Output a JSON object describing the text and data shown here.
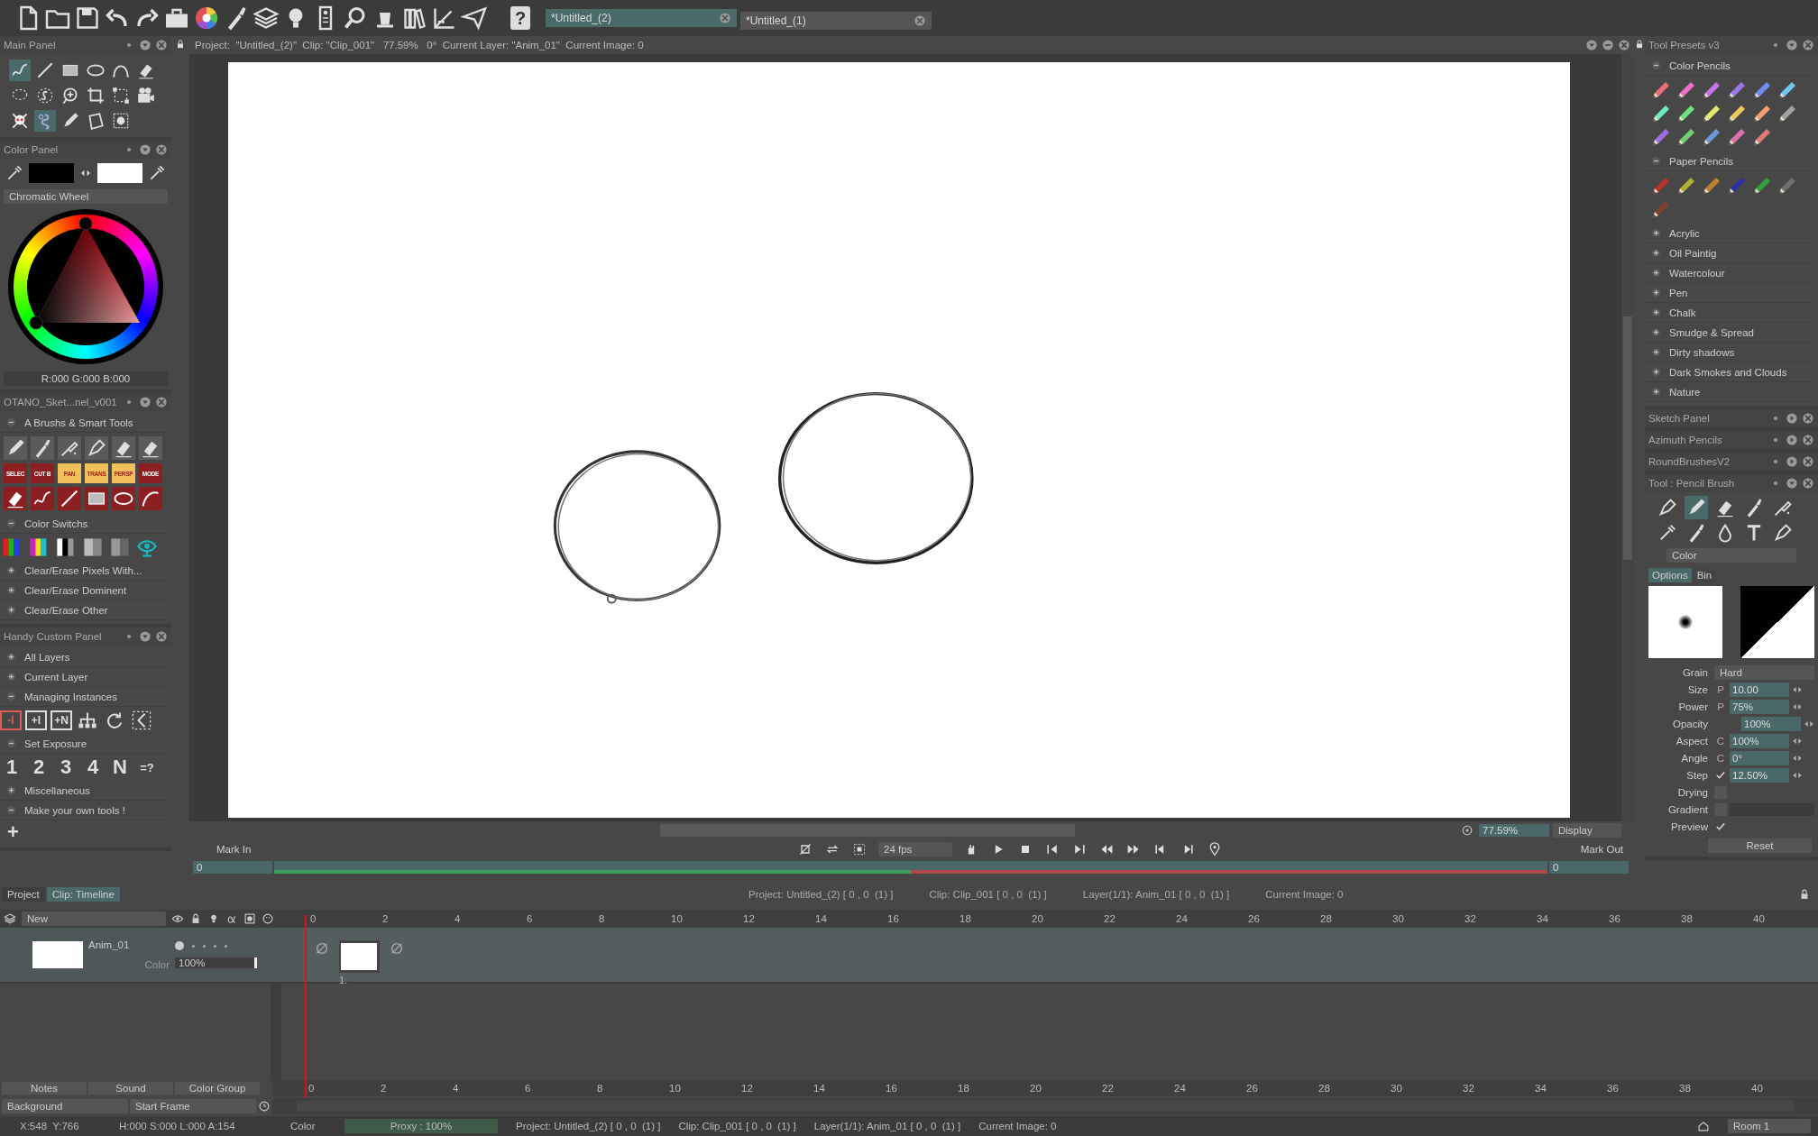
{
  "toolbar": {
    "help_label": "?",
    "documents": [
      {
        "title": "*Untitled_(2)",
        "selected": true
      },
      {
        "title": "*Untitled_(1)",
        "selected": false
      }
    ]
  },
  "left_panels": [
    {
      "kind": "main_tools",
      "title": "Main Panel",
      "expanded": true
    },
    {
      "kind": "color",
      "title": "Color Panel",
      "expanded": true,
      "mode": "Chromatic Wheel",
      "readout": "R:000 G:000 B:000"
    },
    {
      "kind": "groups",
      "title": "OTANO_Sket...nel_v001",
      "expanded": true,
      "groups": [
        {
          "kind": "brush_tools",
          "label": "A Brushs & Smart Tools",
          "expanded": true,
          "buttons": [
            {
              "label": "SELEC",
              "color": "#8b1f22"
            },
            {
              "label": "CUT B",
              "color": "#8b1f22"
            },
            {
              "label": "PAN",
              "color": "#f2c05a"
            },
            {
              "label": "TRANS",
              "color": "#f2c05a"
            },
            {
              "label": "PERSP",
              "color": "#f2c05a"
            },
            {
              "label": "MODE",
              "color": "#8b1f22"
            }
          ]
        },
        {
          "kind": "swatches",
          "label": "Color Switchs",
          "expanded": true
        },
        {
          "label": "Clear/Erase Pixels With...",
          "expanded": false
        },
        {
          "label": "Clear/Erase Dominent",
          "expanded": false
        },
        {
          "label": "Clear/Erase Other",
          "expanded": false
        }
      ]
    },
    {
      "kind": "groups",
      "title": "Handy Custom Panel",
      "expanded": true,
      "add_label": "+",
      "groups": [
        {
          "label": "All Layers",
          "expanded": false
        },
        {
          "label": "Current Layer",
          "expanded": false
        },
        {
          "kind": "instances",
          "label": "Managing Instances",
          "expanded": true,
          "buttons": [
            {
              "label": "-I",
              "color": "#e05a5a"
            },
            {
              "label": "+I",
              "color": "#dddddd"
            },
            {
              "label": "+N",
              "color": "#dddddd"
            }
          ]
        },
        {
          "kind": "exposure",
          "label": "Set Exposure",
          "expanded": true,
          "buttons": [
            "1",
            "2",
            "3",
            "4",
            "N",
            "=?"
          ]
        },
        {
          "label": "Miscellaneous",
          "expanded": false
        },
        {
          "label": "Make your own tools !",
          "expanded": true
        }
      ]
    }
  ],
  "canvas": {
    "info": "Project:  \"Untitled_(2)\"  Clip: \"Clip_001\"   77.59%   0°  Current Layer: \"Anim_01\"  Current Image: 0",
    "zoom": "77.59%",
    "view_mode": "Display",
    "mark_in": "Mark In",
    "mark_out": "Mark Out",
    "fps": "24 fps",
    "start_frame": "0",
    "end_frame": "0",
    "cache": {
      "level": 0.5
    }
  },
  "right_panels": [
    {
      "kind": "presets",
      "title": "Tool Presets v3",
      "expanded": true,
      "groups": [
        {
          "kind": "pencils",
          "label": "Color Pencils",
          "expanded": true,
          "pencils": [
            {
              "color": "#e8707a"
            },
            {
              "color": "#ee6fc8"
            },
            {
              "color": "#c874e6"
            },
            {
              "color": "#9a78ea"
            },
            {
              "color": "#6f8cf0"
            },
            {
              "color": "#6cc8f0"
            },
            {
              "color": "#6ee8c0"
            },
            {
              "color": "#6ee080"
            },
            {
              "color": "#e0e870"
            },
            {
              "color": "#f0c860"
            },
            {
              "color": "#f0a070"
            },
            {
              "color": "#a0a0a0"
            },
            {
              "color": "#9a70e0"
            },
            {
              "color": "#70d070"
            },
            {
              "color": "#6a98d8"
            },
            {
              "color": "#e070a8"
            },
            {
              "color": "#e07a7a"
            }
          ]
        },
        {
          "kind": "pencils",
          "label": "Paper Pencils",
          "expanded": true,
          "pencils": [
            {
              "color": "#b83030"
            },
            {
              "color": "#b0b030"
            },
            {
              "color": "#c08030"
            },
            {
              "color": "#3030a0"
            },
            {
              "color": "#30a040"
            },
            {
              "color": "#707070"
            },
            {
              "color": "#804030"
            }
          ]
        },
        {
          "label": "Acrylic",
          "expanded": false
        },
        {
          "label": "Oil Paintig",
          "expanded": false
        },
        {
          "label": "Watercolour",
          "expanded": false
        },
        {
          "label": "Pen",
          "expanded": false
        },
        {
          "label": "Chalk",
          "expanded": false
        },
        {
          "label": "Smudge & Spread",
          "expanded": false
        },
        {
          "label": "Dirty shadows",
          "expanded": false
        },
        {
          "label": "Dark Smokes and Clouds",
          "expanded": false
        },
        {
          "label": "Nature",
          "expanded": false
        }
      ]
    },
    {
      "title": "Sketch Panel",
      "expanded": false
    },
    {
      "title": "Azimuth Pencils",
      "expanded": false
    },
    {
      "title": "RoundBrushesV2",
      "expanded": false
    },
    {
      "kind": "tool",
      "title": "Tool : Pencil Brush",
      "expanded": true,
      "mode": "Color",
      "tabs": [
        {
          "label": "Options",
          "selected": true
        },
        {
          "label": "Bin",
          "selected": false
        }
      ],
      "grain_label": "Grain",
      "grain": "Hard",
      "reset": "Reset",
      "params": [
        {
          "kind": "value",
          "label": "Size",
          "prefix": "P",
          "value": "10.00"
        },
        {
          "kind": "value",
          "label": "Power",
          "prefix": "P",
          "value": "75%"
        },
        {
          "kind": "value",
          "label": "Opacity",
          "value": "100%"
        },
        {
          "kind": "value",
          "label": "Aspect",
          "prefix": "C",
          "value": "100%"
        },
        {
          "kind": "value",
          "label": "Angle",
          "prefix": "C",
          "value": "0°"
        },
        {
          "kind": "check_value",
          "label": "Step",
          "checked": true,
          "value": "12.50%"
        },
        {
          "kind": "check",
          "label": "Drying",
          "checked": false
        },
        {
          "kind": "check_bar",
          "label": "Gradient",
          "checked": false
        },
        {
          "kind": "check",
          "label": "Preview",
          "checked": true
        }
      ]
    }
  ],
  "timeline": {
    "tabs": [
      {
        "label": "Project",
        "selected": false
      },
      {
        "label": "Clip: Timeline",
        "selected": true
      }
    ],
    "info": [
      "Project: Untitled_(2) [ 0 , 0  (1) ]",
      "Clip: Clip_001 [ 0 , 0  (1) ]",
      "Layer(1/1): Anim_01 [ 0 , 0  (1) ]",
      "Current Image: 0"
    ],
    "layer_filter": "New",
    "ruler": [
      "0",
      "2",
      "4",
      "6",
      "8",
      "10",
      "12",
      "14",
      "16",
      "18",
      "20",
      "22",
      "24",
      "26",
      "28",
      "30",
      "32",
      "34",
      "36",
      "38",
      "40"
    ],
    "layers": [
      {
        "name": "Anim_01",
        "mode": "Color",
        "opacity": "100%",
        "frame_label": "1."
      }
    ],
    "buttons": [
      "Notes",
      "Sound",
      "Color Group"
    ],
    "bottom_ruler": [
      "0",
      "2",
      "4",
      "6",
      "8",
      "10",
      "12",
      "14",
      "16",
      "18",
      "20",
      "22",
      "24",
      "26",
      "28",
      "30",
      "32",
      "34",
      "36",
      "38",
      "40"
    ],
    "background": "Background",
    "start_frame": "Start Frame"
  },
  "status_bar": {
    "position": "X:548  Y:766",
    "color_values": "H:000 S:000 L:000 A:154",
    "mode": "Color",
    "proxy": "Proxy : 100%",
    "info": [
      "Project: Untitled_(2) [ 0 , 0  (1) ]",
      "Clip: Clip_001 [ 0 , 0  (1) ]",
      "Layer(1/1): Anim_01 [ 0 , 0  (1) ]",
      "Current Image: 0"
    ],
    "room": "Room 1"
  }
}
